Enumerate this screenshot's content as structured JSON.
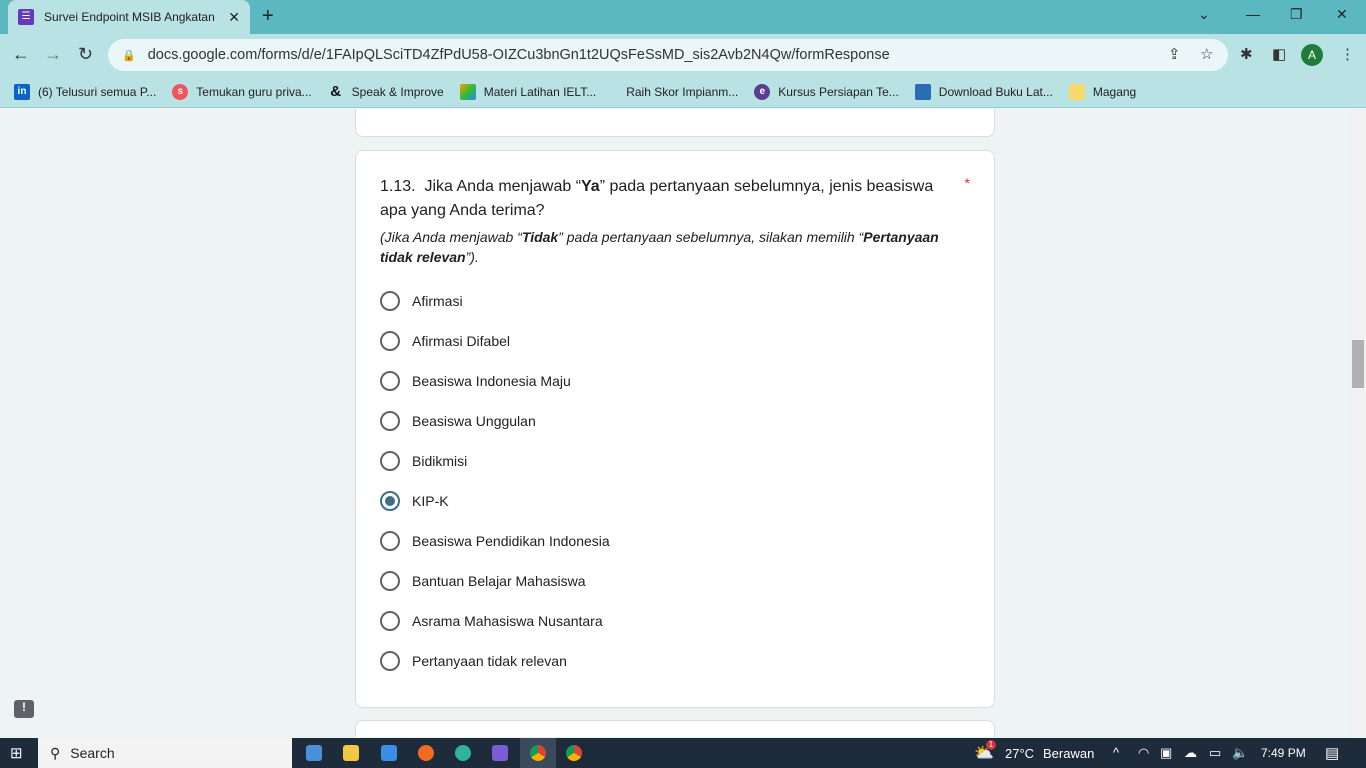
{
  "browser": {
    "tab_title": "Survei Endpoint MSIB Angkatan",
    "url": "docs.google.com/forms/d/e/1FAIpQLSciTD4ZfPdU58-OIZCu3bnGn1t2UQsFeSsMD_sis2Avb2N4Qw/formResponse",
    "avatar": "A"
  },
  "bookmarks": [
    "(6) Telusuri semua P...",
    "Temukan guru priva...",
    "Speak & Improve",
    "Materi Latihan IELT...",
    "Raih Skor Impianm...",
    "Kursus Persiapan Te...",
    "Download Buku Lat...",
    "Magang"
  ],
  "question": {
    "number": "1.13.",
    "title_pre": "Jika Anda menjawab “",
    "title_bold": "Ya",
    "title_post": "” pada pertanyaan sebelumnya, jenis beasiswa apa yang Anda terima?",
    "required": "*",
    "desc_pre": "(Jika Anda menjawab “",
    "desc_bold1": "Tidak",
    "desc_mid": "” pada pertanyaan sebelumnya, silakan memilih “",
    "desc_bold2": "Pertanyaan tidak relevan",
    "desc_post": "”).",
    "options": [
      "Afirmasi",
      "Afirmasi Difabel",
      "Beasiswa Indonesia Maju",
      "Beasiswa Unggulan",
      "Bidikmisi",
      "KIP-K",
      "Beasiswa Pendidikan Indonesia",
      "Bantuan Belajar Mahasiswa",
      "Asrama Mahasiswa Nusantara",
      "Pertanyaan tidak relevan"
    ],
    "selected": "KIP-K"
  },
  "taskbar": {
    "search": "Search",
    "weather_temp": "27°C",
    "weather_text": "Berawan",
    "weather_badge": "1",
    "time": "7:49 PM"
  }
}
